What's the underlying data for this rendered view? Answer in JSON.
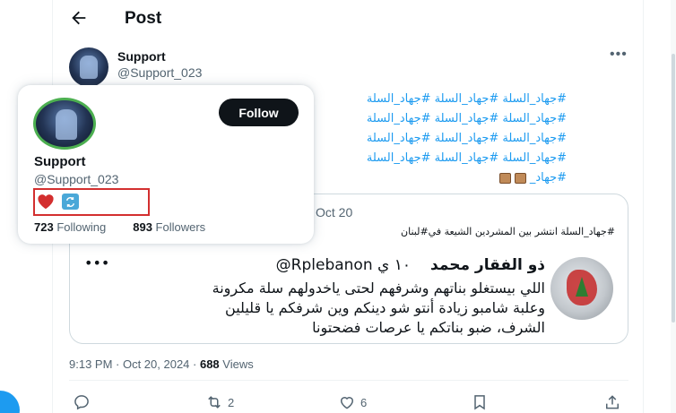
{
  "header": {
    "back_icon": "arrow-left-icon",
    "title": "Post"
  },
  "author": {
    "name": "Support",
    "handle": "@Support_023"
  },
  "tweet": {
    "lines": [
      "#جهاد_السلة #جهاد_السلة #جهاد_السلة",
      "#جهاد_السلة #جهاد_السلة #جهاد_السلة",
      "#جهاد_السلة #جهاد_السلة #جهاد_السلة",
      "#جهاد_السلة #جهاد_السلة #جهاد_السلة"
    ],
    "last_line": "#جهاد_"
  },
  "quote": {
    "date": "Oct 20",
    "text": "#جهاد_السلة انتشر بين المشردين الشيعة في#لبنان",
    "inner": {
      "name": "ذو الفقار محمد",
      "handle": "@Rplebanon",
      "time": "١٠ ي",
      "lines": [
        "اللي بيستغلو بناتهم وشرفهم لحتى ياخدولهم سلة مكرونة",
        "وعلبة شامبو زيادة أنتو شو دينكم وين شرفكم يا قليلين",
        "الشرف، ضبو بناتكم يا عرصات فضحتونا"
      ]
    }
  },
  "meta": {
    "time": "9:13 PM · Oct 20, 2024 · ",
    "views": "688",
    "views_label": " Views"
  },
  "actions": {
    "retweets": "2",
    "likes": "6"
  },
  "hover_card": {
    "name": "Support",
    "handle": "@Support_023",
    "follow_label": "Follow",
    "following_count": "723",
    "following_label": " Following",
    "followers_count": "893",
    "followers_label": " Followers",
    "badge_icons": [
      "red-heart-icon",
      "repeat-emoji-icon"
    ],
    "highlight_color": "#d32f2f"
  },
  "colors": {
    "accent": "#1d9bf0",
    "text": "#0f1419",
    "muted": "#536471"
  }
}
